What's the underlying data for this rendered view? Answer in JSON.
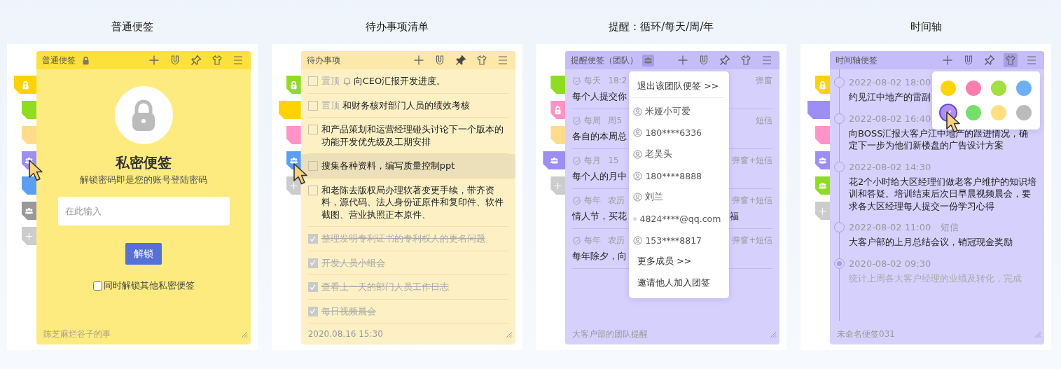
{
  "panels": [
    {
      "caption": "普通便签",
      "kind": "private",
      "title": "普通便签",
      "title_badge": {
        "kind": "lock",
        "active": false
      },
      "pinned": false,
      "skin_active": false,
      "tabs": [
        {
          "color": "#ffd200",
          "kind": "lock",
          "selected": true
        },
        {
          "color": "#8fdd1f",
          "kind": "plain",
          "selected": false
        },
        {
          "color": "#fedc8a",
          "kind": "plain",
          "selected": false
        },
        {
          "color": "#9d8ef5",
          "kind": "team",
          "selected": false
        },
        {
          "color": "#5b9ff3",
          "kind": "plain",
          "selected": false
        },
        {
          "color": "#999999",
          "kind": "team",
          "selected": false
        },
        {
          "color": "#cccccc",
          "kind": "plus",
          "selected": false
        }
      ],
      "lock": {
        "heading": "私密便签",
        "hint": "解锁密码即是您的账号登陆密码",
        "placeholder": "在此输入",
        "button": "解锁",
        "option": {
          "label": "同时解锁其他私密便签",
          "checked": false
        }
      },
      "footer": "陈芝麻烂谷子的事"
    },
    {
      "caption": "待办事项清单",
      "kind": "todo",
      "title": "待办事项",
      "pinned": true,
      "skin_active": false,
      "tabs": [
        {
          "color": "#8fdd1f",
          "kind": "lock",
          "selected": false
        },
        {
          "color": "#ffd200",
          "kind": "plain",
          "selected": true
        },
        {
          "color": "#ff92c6",
          "kind": "plain",
          "selected": false
        },
        {
          "color": "#5b9ff3",
          "kind": "team",
          "selected": false
        },
        {
          "color": "#cccccc",
          "kind": "plus",
          "selected": false
        }
      ],
      "todos": [
        {
          "tag": "置顶",
          "bell": true,
          "text": "向CEO汇报开发进度。",
          "checked": false,
          "hovered": false
        },
        {
          "tag": "置顶",
          "bell": false,
          "text": "和财务核对部门人员的绩效考核",
          "checked": false,
          "hovered": false
        },
        {
          "bell": false,
          "text": "和产品策划和运营经理碰头讨论下一个版本的功能开发优先级及工期安排",
          "checked": false,
          "hovered": false
        },
        {
          "bell": false,
          "text": "搜集各种资料，编写质量控制ppt",
          "checked": false,
          "hovered": true
        },
        {
          "bell": false,
          "text": "和老陈去版权局办理软著变更手续，带齐资料，源代码、法人身份证原件和复印件、软件截图、营业执照正本原件、",
          "checked": false,
          "hovered": false
        },
        {
          "bell": false,
          "text": "整理发明专利证书的专利权人的更名问题",
          "checked": true,
          "hovered": false
        },
        {
          "bell": false,
          "text": "开发人员小组会",
          "checked": true,
          "hovered": false
        },
        {
          "bell": false,
          "text": "查看上一天的部门人员工作日志",
          "checked": true,
          "hovered": false
        },
        {
          "bell": false,
          "text": "每日视频晨会",
          "checked": true,
          "hovered": false
        }
      ],
      "footer": "2020.08.16  15:30"
    },
    {
      "caption": "提醒：循环/每天/周/年",
      "kind": "reminder",
      "title": "提醒便签（团队）",
      "title_badge": {
        "kind": "team",
        "active": true
      },
      "pinned": false,
      "skin_active": false,
      "tabs": [
        {
          "color": "#8fdd1f",
          "kind": "plain",
          "selected": false
        },
        {
          "color": "#ff92c6",
          "kind": "lock",
          "selected": false
        },
        {
          "color": "#fedc8a",
          "kind": "plain",
          "selected": false
        },
        {
          "color": "#9d8ef5",
          "kind": "team",
          "selected": true
        },
        {
          "color": "#cccccc",
          "kind": "plus",
          "selected": false
        }
      ],
      "reminders": [
        {
          "repeat": "每天",
          "when": "18:2",
          "channel": "弹窗",
          "text": "每个人提交你"
        },
        {
          "repeat": "每周",
          "when": "周5",
          "channel": "短信",
          "text": "各自的本周总"
        },
        {
          "repeat": "每月",
          "when": "15",
          "channel": "弹窗+短信",
          "text": "每个人的月中"
        },
        {
          "repeat": "每年",
          "when": "农历",
          "channel": "弹窗+短信",
          "text": "情人节，买花",
          "tail": "福"
        },
        {
          "repeat": "每年",
          "when": "农历",
          "channel": "弹窗+短信",
          "text": "每年除夕，向"
        }
      ],
      "team_menu": [
        {
          "kind": "action",
          "text": "退出该团队便签 >>"
        },
        {
          "kind": "member",
          "text": "米娅小可爱"
        },
        {
          "kind": "member",
          "text": "180****6336"
        },
        {
          "kind": "member",
          "text": "老吴头"
        },
        {
          "kind": "member",
          "text": "180****8888"
        },
        {
          "kind": "member",
          "text": "刘兰"
        },
        {
          "kind": "member",
          "text": "4824****@qq.com"
        },
        {
          "kind": "member",
          "text": "153****8817"
        },
        {
          "kind": "action",
          "text": "更多成员 >>"
        },
        {
          "kind": "action",
          "text": "邀请他人加入团签"
        }
      ],
      "footer": "大客户部的团队提醒"
    },
    {
      "caption": "时间轴",
      "kind": "timeline",
      "title": "时间轴便签",
      "pinned": false,
      "skin_active": true,
      "tabs": [
        {
          "color": "#ffd200",
          "kind": "lock",
          "selected": false
        },
        {
          "color": "#9d8ef5",
          "kind": "plain",
          "selected": true
        },
        {
          "color": "#ff92c6",
          "kind": "plain",
          "selected": false
        },
        {
          "color": "#9d8ef5",
          "kind": "team",
          "selected": false
        },
        {
          "color": "#8fdd1f",
          "kind": "team",
          "selected": false
        },
        {
          "color": "#cccccc",
          "kind": "plus",
          "selected": false
        }
      ],
      "timeline": [
        {
          "time": "2022-08-02  18:00",
          "text": "约见江中地产的雷副",
          "done": false
        },
        {
          "time": "2022-08-02  16:40",
          "text": "向BOSS汇报大客户江中地产的跟进情况，确定下一步为他们新楼盘的广告设计方案",
          "done": false
        },
        {
          "time": "2022-08-02  14:30",
          "text": "花2个小时给大区经理们做老客户维护的知识培训和答疑。培训结束后次日早晨视频晨会，要求各大区经理每人提交一份学习心得",
          "done": false
        },
        {
          "time": "2022-08-02  11:00",
          "channel": "短信",
          "text": "大客户部的上月总结会议，销冠现金奖励",
          "done": false
        },
        {
          "time": "2020-08-02  09:30",
          "text": "统计上周各大客户经理的业绩及转化，完成",
          "done": true
        }
      ],
      "palette": [
        {
          "color": "#ffd400",
          "selected": false
        },
        {
          "color": "#ff7eb0",
          "selected": false
        },
        {
          "color": "#a0e040",
          "selected": false
        },
        {
          "color": "#6cb0f5",
          "selected": false
        },
        {
          "color": "#b48cf8",
          "selected": true
        },
        {
          "color": "#74e06a",
          "selected": false
        },
        {
          "color": "#ffdf80",
          "selected": false
        },
        {
          "color": "#bbbbbb",
          "selected": false
        }
      ],
      "footer": "未命名便签031"
    }
  ]
}
